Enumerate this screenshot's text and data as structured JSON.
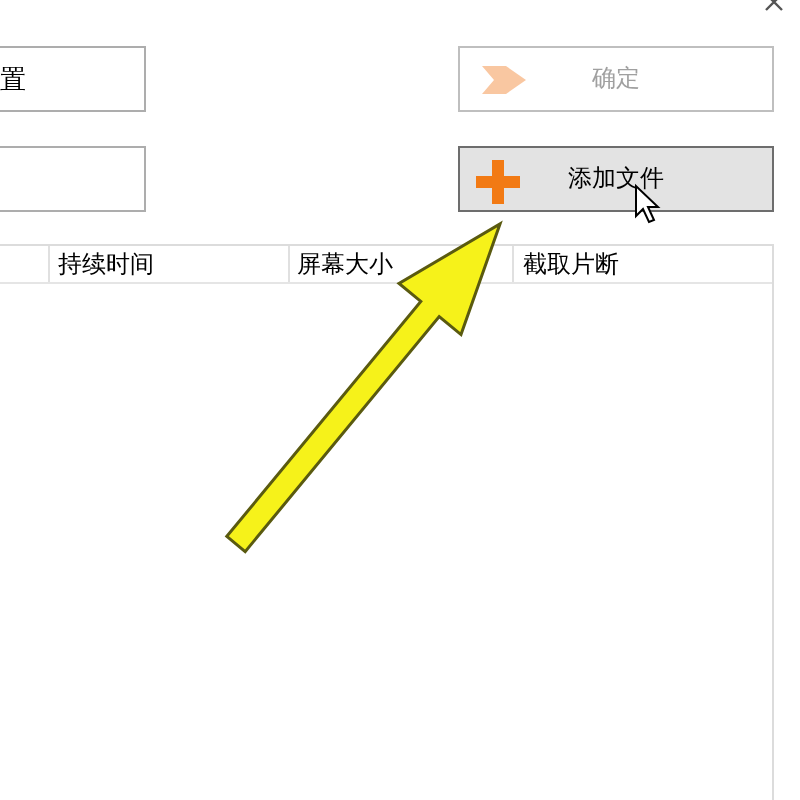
{
  "left_buttons": [
    {
      "kind": "labeled",
      "label": "置"
    },
    {
      "kind": "blank"
    }
  ],
  "right_buttons": [
    {
      "kind": "confirm",
      "label": "确定",
      "disabled": true,
      "hovered": false
    },
    {
      "kind": "add",
      "label": "添加文件",
      "disabled": false,
      "hovered": true
    }
  ],
  "table": {
    "columns": [
      "持续时间",
      "屏幕大小",
      "截取片断"
    ]
  }
}
